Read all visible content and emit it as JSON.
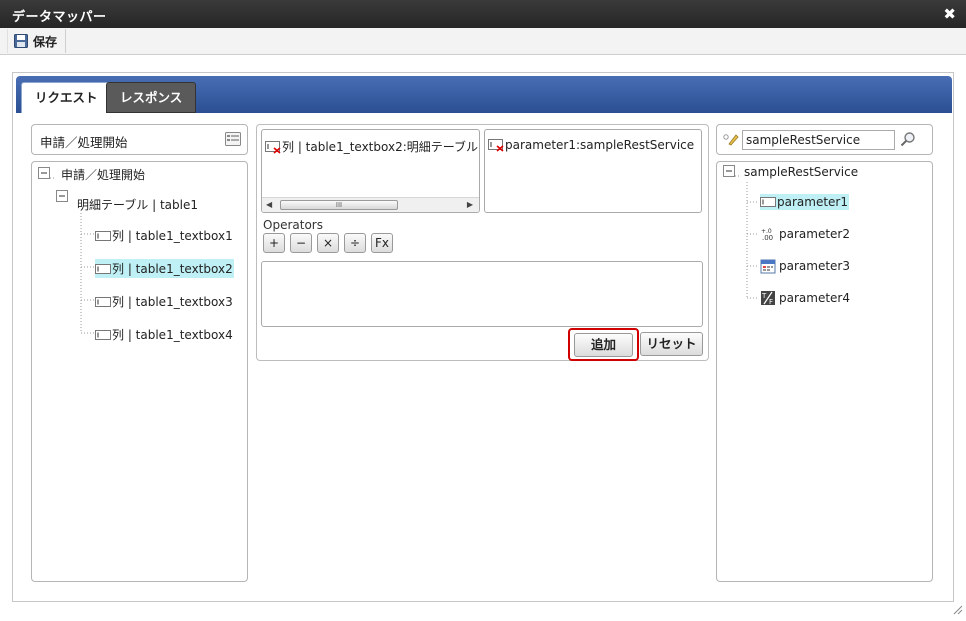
{
  "window": {
    "title": "データマッパー"
  },
  "toolbar": {
    "save_label": "保存"
  },
  "tabs": [
    {
      "label": "リクエスト",
      "active": true
    },
    {
      "label": "レスポンス",
      "active": false
    }
  ],
  "left": {
    "header": "申請／処理開始",
    "tree": {
      "root": "申請／処理開始",
      "table": "明細テーブル | table1",
      "columns": [
        "列 | table1_textbox1",
        "列 | table1_textbox2",
        "列 | table1_textbox3",
        "列 | table1_textbox4"
      ],
      "selected_index": 1
    }
  },
  "center": {
    "source_text": "列 | table1_textbox2:明細テーブル | table1",
    "target_text": "parameter1:sampleRestService",
    "scroll_thumb_glyph": "III",
    "operators_label": "Operators",
    "operators": [
      "+",
      "−",
      "×",
      "÷",
      "Fx"
    ],
    "add_label": "追加",
    "reset_label": "リセット"
  },
  "right": {
    "search_value": "sampleRestService",
    "tree": {
      "root": "sampleRestService",
      "params": [
        {
          "label": "parameter1",
          "icon": "text-field-icon",
          "selected": true
        },
        {
          "label": "parameter2",
          "icon": "number-icon",
          "selected": false
        },
        {
          "label": "parameter3",
          "icon": "calendar-icon",
          "selected": false
        },
        {
          "label": "parameter4",
          "icon": "boolean-icon",
          "selected": false
        }
      ]
    }
  },
  "colors": {
    "tab_band": "#2b4f92",
    "selection": "#bff0f5",
    "highlight_border": "#d00000"
  }
}
